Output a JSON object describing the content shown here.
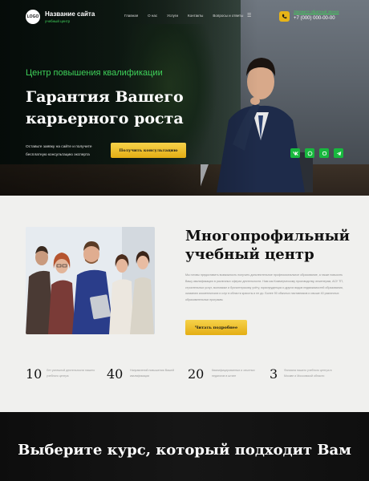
{
  "header": {
    "logo_text": "LOGO",
    "site_name": "Название сайта",
    "site_subtitle": "учебный центр",
    "nav": [
      "Главная",
      "О нас",
      "Услуги",
      "Контакты",
      "Вопросы и ответы"
    ],
    "callback_text": "Закажите обратный звонок",
    "phone": "+7 (000) 000-00-00"
  },
  "hero": {
    "kicker": "Центр повышения квалификации",
    "title": "Гарантия Вашего карьерного роста",
    "text": "Оставьте заявку на сайте и получите бесплатную консультацию эксперта",
    "button": "Получить консультацию",
    "socials": [
      "vk-icon",
      "whatsapp-icon",
      "viber-icon",
      "telegram-icon"
    ]
  },
  "about": {
    "title": "Многопрофильный учебный центр",
    "text": "Мы готовы предоставить возможность получить дополнительное профессиональное образование, а также повысить Вашу квалификацию в различных сферах деятельности. Нам как Коммерческому производству, инженерам, АСУ ТП, строительных услуг, экономике и бухгалтерскому учёту, юриспруденции и других видов недвижимостей образования, оказанию косметических и слуг в области красоты и не до. Более 90 обычных наставников и свыше 40 различных образовательных программ.",
    "button": "Читать подробнее"
  },
  "stats": [
    {
      "num": "10",
      "text": "Лет успешной деятельности нашего учебного центра"
    },
    {
      "num": "40",
      "text": "Направлений повышения Вашей квалификации"
    },
    {
      "num": "20",
      "text": "Квалифицированных и опытных педагогов в штате"
    },
    {
      "num": "3",
      "text": "Филиала нашего учебного центра в Москве и Московской области"
    }
  ],
  "courses": {
    "title": "Выберите курс, который подходит Вам"
  },
  "colors": {
    "accent_green": "#3fd15a",
    "accent_yellow": "#e7b418",
    "social_green": "#18b83e"
  }
}
